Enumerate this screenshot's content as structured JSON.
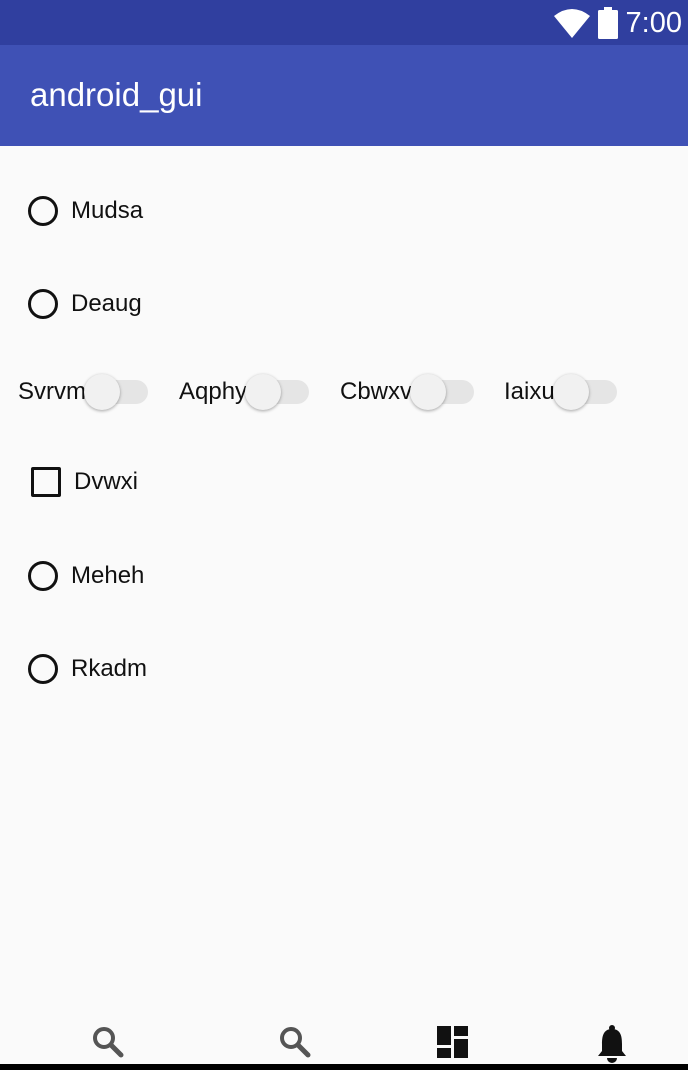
{
  "status_bar": {
    "time": "7:00",
    "icons": [
      "wifi-icon",
      "battery-icon"
    ]
  },
  "app_bar": {
    "title": "android_gui"
  },
  "items": [
    {
      "type": "radio",
      "label": "Mudsa",
      "checked": false
    },
    {
      "type": "radio",
      "label": "Deaug",
      "checked": false
    }
  ],
  "switches": [
    {
      "label": "Svrvm",
      "on": false
    },
    {
      "label": "Aqphy",
      "on": false
    },
    {
      "label": "Cbwxv",
      "on": false
    },
    {
      "label": "Iaixu",
      "on": false
    }
  ],
  "items_after": [
    {
      "type": "checkbox",
      "label": "Dvwxi",
      "checked": false
    },
    {
      "type": "radio",
      "label": "Meheh",
      "checked": false
    },
    {
      "type": "radio",
      "label": "Rkadm",
      "checked": false
    }
  ],
  "bottom_nav": [
    "search-icon",
    "search-icon",
    "dashboard-icon",
    "notifications-icon"
  ],
  "colors": {
    "status_bar": "#303f9f",
    "app_bar": "#3f51b5",
    "background": "#fafafa"
  }
}
